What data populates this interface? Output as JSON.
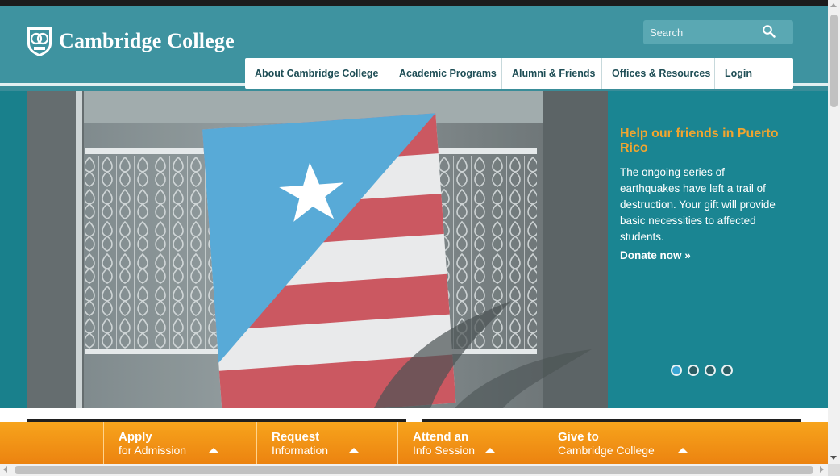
{
  "header": {
    "logo_text": "Cambridge College",
    "logo_icon": "cambridge-college-crest",
    "search_placeholder": "Search",
    "search_icon": "magnifier-icon"
  },
  "nav": {
    "items": [
      "About Cambridge College",
      "Academic Programs",
      "Alumni & Friends",
      "Offices & Resources",
      "Login"
    ]
  },
  "slide": {
    "title": "Help our friends in Puerto Rico",
    "body": "The ongoing series of earthquakes have left a trail of destruction. Your gift will provide basic necessities to affected students.",
    "link": "Donate now »",
    "image": "puerto-rico-flag-on-balcony",
    "dots": [
      "1",
      "2",
      "3",
      "4"
    ],
    "active_dot": 1
  },
  "cta": {
    "apply": {
      "main": "Apply",
      "sub": "for Admission"
    },
    "request": {
      "main": "Request",
      "sub": "Information"
    },
    "attend": {
      "main": "Attend an",
      "sub": "Info Session"
    },
    "give": {
      "main": "Give to",
      "sub": "Cambridge College"
    }
  },
  "colors": {
    "header_teal": "#3e93a0",
    "slide_teal": "#1a8592",
    "accent_orange": "#f1a52f",
    "cta_orange": "#ec8310",
    "nav_text": "#1f4e56"
  }
}
